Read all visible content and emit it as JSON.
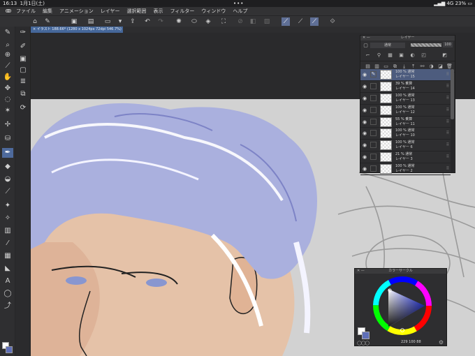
{
  "status_bar": {
    "time": "16:13",
    "date": "1月1日(土)",
    "center_dots": "•••",
    "network": "4G",
    "battery": "23%"
  },
  "menu": {
    "app_icon": "clip-studio-icon",
    "items": [
      "ファイル",
      "編集",
      "アニメーション",
      "レイヤー",
      "選択範囲",
      "表示",
      "フィルター",
      "ウィンドウ",
      "ヘルプ"
    ]
  },
  "document_tab": {
    "close_glyph": "×",
    "title": "イラスト 188.66* (1280 x 1024px 72dpi 546.7%)"
  },
  "layer_panel": {
    "title": "レイヤー",
    "blend_mode": "通常",
    "opacity": "100",
    "layers": [
      {
        "opacity_mode": "100 % 通常",
        "name": "レイヤー 15",
        "selected": true
      },
      {
        "opacity_mode": "39 % 乗算",
        "name": "レイヤー 14",
        "selected": false
      },
      {
        "opacity_mode": "100 % 通常",
        "name": "レイヤー 13",
        "selected": false
      },
      {
        "opacity_mode": "100 % 通常",
        "name": "レイヤー 12",
        "selected": false
      },
      {
        "opacity_mode": "55 % 乗算",
        "name": "レイヤー 11",
        "selected": false
      },
      {
        "opacity_mode": "100 % 通常",
        "name": "レイヤー 10",
        "selected": false
      },
      {
        "opacity_mode": "100 % 通常",
        "name": "レイヤー 6",
        "selected": false
      },
      {
        "opacity_mode": "21 % 通常",
        "name": "レイヤー 3",
        "selected": false
      },
      {
        "opacity_mode": "100 % 通常",
        "name": "レイヤー 2",
        "selected": false
      }
    ]
  },
  "color_panel": {
    "title": "カラーサークル",
    "readout": "229 100 88",
    "current_color": "#5f6fb8",
    "background_color": "#ffffff"
  },
  "colors": {
    "accent": "#4e6a9c",
    "selected_layer": "#4d5c7e"
  }
}
